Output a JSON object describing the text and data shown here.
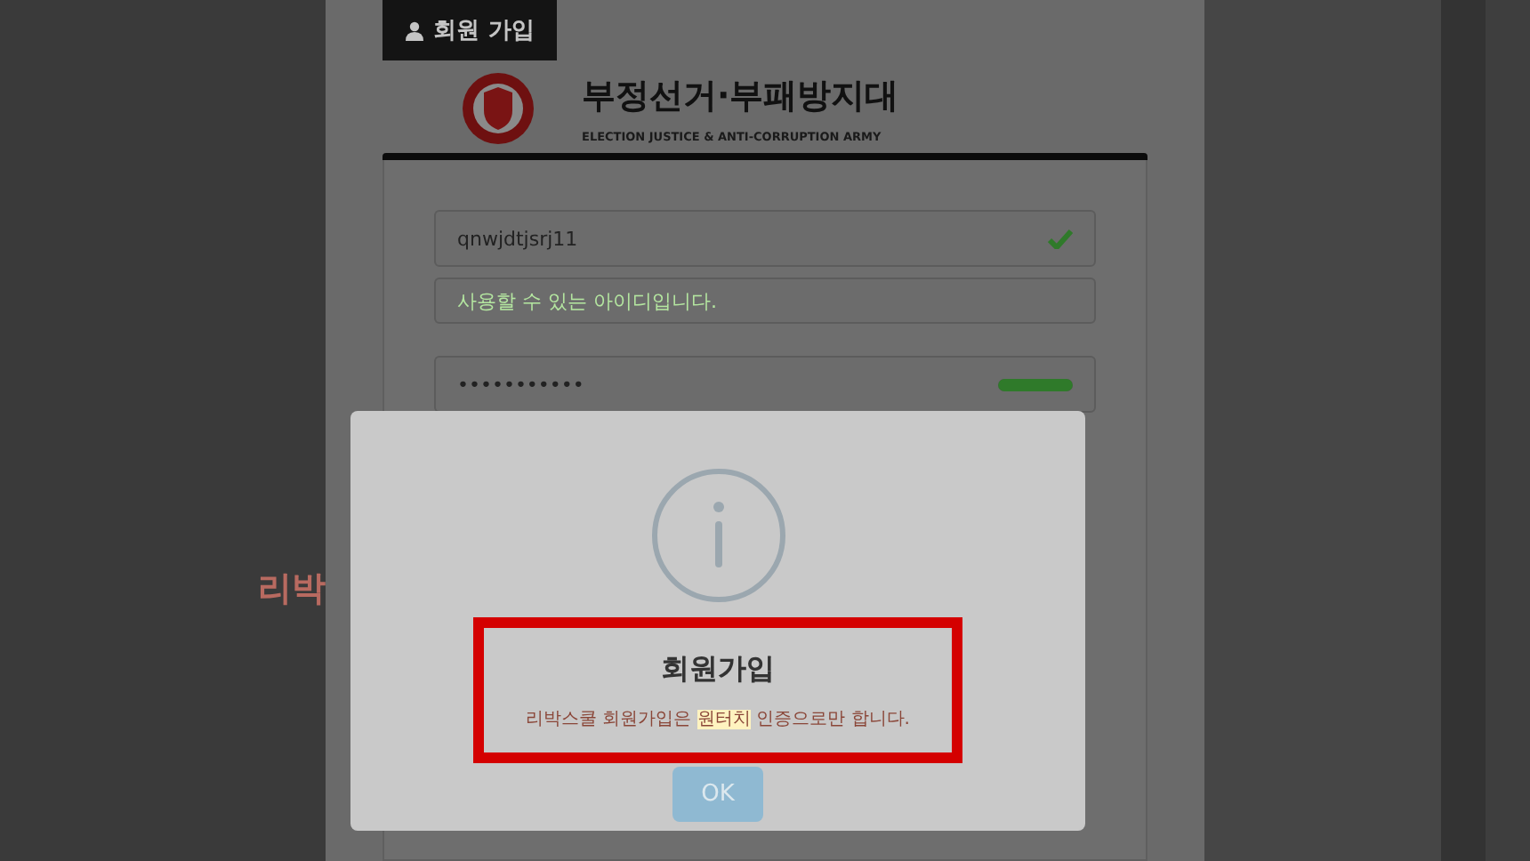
{
  "background_text": "리박",
  "page": {
    "tab": {
      "label": "회원 가입"
    },
    "brand": {
      "title": "부정선거·부패방지대",
      "subtitle": "ELECTION JUSTICE & ANTI-CORRUPTION ARMY"
    },
    "id_field": {
      "value": "qnwjdtjsrj11",
      "valid": true
    },
    "id_message": "사용할 수 있는 아이디입니다.",
    "password_field": {
      "value": "•••••••••••",
      "level": 1
    }
  },
  "dialog": {
    "title": "회원가입",
    "message": [
      {
        "text": "리박스쿨 회원가입은 ",
        "highlighted": false
      },
      {
        "text": "원터치",
        "highlighted": true
      },
      {
        "text": " 인증으로만 합니다.",
        "highlighted": false
      }
    ],
    "button": "OK"
  }
}
